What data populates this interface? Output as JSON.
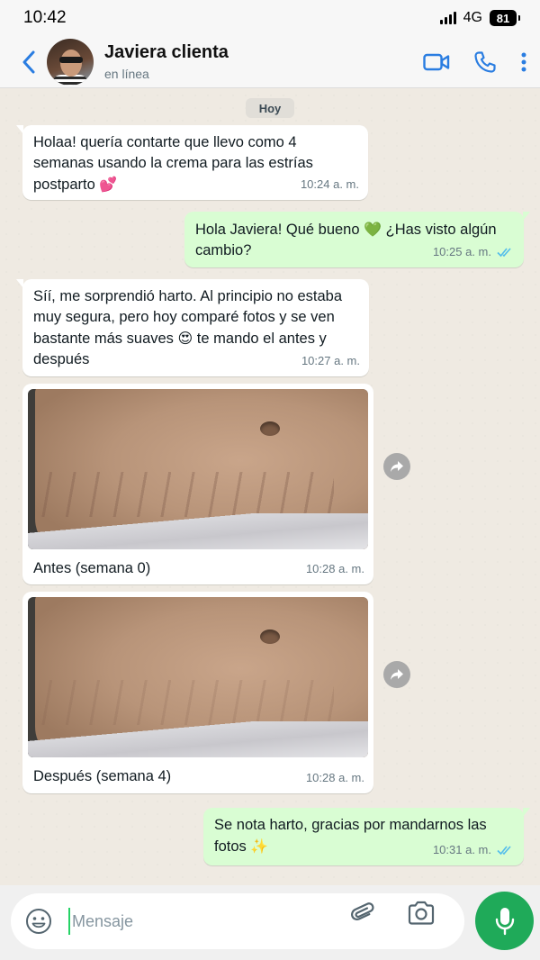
{
  "status_bar": {
    "time": "10:42",
    "network": "4G",
    "battery": "81"
  },
  "header": {
    "contact_name": "Javiera clienta",
    "contact_status": "en línea"
  },
  "day_label": "Hoy",
  "messages": [
    {
      "text": "Holaa! quería contarte que llevo como 4 semanas usando la crema para las estrías postparto",
      "emoji": "💕",
      "time": "10:24 a. m."
    },
    {
      "text": "Hola Javiera! Qué bueno",
      "emoji": "💚",
      "text2": "¿Has visto algún cambio?",
      "time": "10:25 a. m."
    },
    {
      "text": "Síí, me sorprendió harto. Al principio no estaba muy segura, pero hoy comparé fotos y se ven bastante más suaves",
      "emoji": "😍",
      "text2": "te mando el antes y después",
      "time": "10:27 a. m."
    },
    {
      "caption": "Antes (semana 0)",
      "time": "10:28 a. m."
    },
    {
      "caption": "Después (semana 4)",
      "time": "10:28 a. m."
    },
    {
      "text": "Se nota harto, gracias por mandarnos las fotos",
      "emoji": "✨",
      "time": "10:31 a. m."
    }
  ],
  "input": {
    "placeholder": "Mensaje"
  },
  "colors": {
    "accent_blue": "#2a7de1",
    "outgoing_bubble": "#d9fdd3",
    "mic_button": "#1faa59",
    "read_ticks": "#53bdeb"
  },
  "icons": [
    "back-arrow-icon",
    "video-call-icon",
    "phone-icon",
    "more-vertical-icon",
    "forward-icon",
    "emoji-icon",
    "attach-icon",
    "camera-icon",
    "mic-icon",
    "double-check-icon"
  ]
}
